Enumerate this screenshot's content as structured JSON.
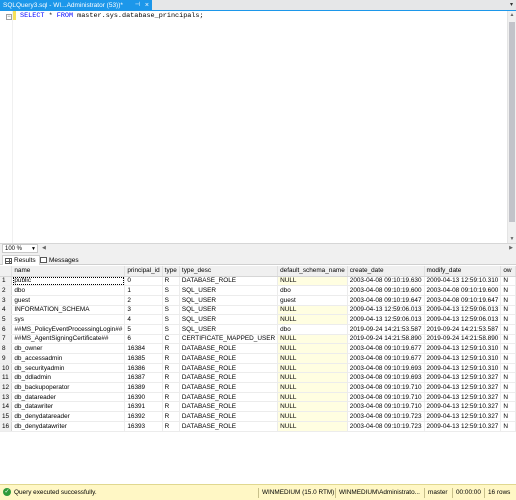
{
  "document_tab": {
    "title": "SQLQuery3.sql - WI...Administrator (53))*",
    "pin_icon": "pin-icon",
    "close_icon": "close-icon"
  },
  "editor": {
    "sql_keywords": [
      "SELECT",
      "FROM"
    ],
    "sql_star": " * ",
    "sql_table": " master.sys.database_principals;"
  },
  "zoom": {
    "value": "100 %"
  },
  "result_tabs": {
    "results_label": "Results",
    "messages_label": "Messages"
  },
  "grid": {
    "columns": [
      "name",
      "principal_id",
      "type",
      "type_desc",
      "default_schema_name",
      "create_date",
      "modify_date",
      "ow"
    ],
    "rows": [
      [
        "1",
        "public",
        "0",
        "R",
        "DATABASE_ROLE",
        "NULL",
        "2003-04-08 09:10:19.630",
        "2009-04-13 12:59:10.310",
        "N"
      ],
      [
        "2",
        "dbo",
        "1",
        "S",
        "SQL_USER",
        "dbo",
        "2003-04-08 09:10:19.600",
        "2003-04-08 09:10:19.600",
        "N"
      ],
      [
        "3",
        "guest",
        "2",
        "S",
        "SQL_USER",
        "guest",
        "2003-04-08 09:10:19.647",
        "2003-04-08 09:10:19.647",
        "N"
      ],
      [
        "4",
        "INFORMATION_SCHEMA",
        "3",
        "S",
        "SQL_USER",
        "NULL",
        "2009-04-13 12:59:06.013",
        "2009-04-13 12:59:06.013",
        "N"
      ],
      [
        "5",
        "sys",
        "4",
        "S",
        "SQL_USER",
        "NULL",
        "2009-04-13 12:59:06.013",
        "2009-04-13 12:59:06.013",
        "N"
      ],
      [
        "6",
        "##MS_PolicyEventProcessingLogin##",
        "5",
        "S",
        "SQL_USER",
        "dbo",
        "2019-09-24 14:21:53.587",
        "2019-09-24 14:21:53.587",
        "N"
      ],
      [
        "7",
        "##MS_AgentSigningCertificate##",
        "6",
        "C",
        "CERTIFICATE_MAPPED_USER",
        "NULL",
        "2019-09-24 14:21:58.890",
        "2019-09-24 14:21:58.890",
        "N"
      ],
      [
        "8",
        "db_owner",
        "16384",
        "R",
        "DATABASE_ROLE",
        "NULL",
        "2003-04-08 09:10:19.677",
        "2009-04-13 12:59:10.310",
        "N"
      ],
      [
        "9",
        "db_accessadmin",
        "16385",
        "R",
        "DATABASE_ROLE",
        "NULL",
        "2003-04-08 09:10:19.677",
        "2009-04-13 12:59:10.310",
        "N"
      ],
      [
        "10",
        "db_securityadmin",
        "16386",
        "R",
        "DATABASE_ROLE",
        "NULL",
        "2003-04-08 09:10:19.693",
        "2009-04-13 12:59:10.310",
        "N"
      ],
      [
        "11",
        "db_ddladmin",
        "16387",
        "R",
        "DATABASE_ROLE",
        "NULL",
        "2003-04-08 09:10:19.693",
        "2009-04-13 12:59:10.327",
        "N"
      ],
      [
        "12",
        "db_backupoperator",
        "16389",
        "R",
        "DATABASE_ROLE",
        "NULL",
        "2003-04-08 09:10:19.710",
        "2009-04-13 12:59:10.327",
        "N"
      ],
      [
        "13",
        "db_datareader",
        "16390",
        "R",
        "DATABASE_ROLE",
        "NULL",
        "2003-04-08 09:10:19.710",
        "2009-04-13 12:59:10.327",
        "N"
      ],
      [
        "14",
        "db_datawriter",
        "16391",
        "R",
        "DATABASE_ROLE",
        "NULL",
        "2003-04-08 09:10:19.710",
        "2009-04-13 12:59:10.327",
        "N"
      ],
      [
        "15",
        "db_denydatareader",
        "16392",
        "R",
        "DATABASE_ROLE",
        "NULL",
        "2003-04-08 09:10:19.723",
        "2009-04-13 12:59:10.327",
        "N"
      ],
      [
        "16",
        "db_denydatawriter",
        "16393",
        "R",
        "DATABASE_ROLE",
        "NULL",
        "2003-04-08 09:10:19.723",
        "2009-04-13 12:59:10.327",
        "N"
      ]
    ]
  },
  "status_bar": {
    "message": "Query executed successfully.",
    "server": "WINMEDIUM (15.0 RTM)",
    "user": "WINMEDIUM\\Administrato...",
    "database": "master",
    "elapsed": "00:00:00",
    "rows": "16 rows",
    "status_icon": "check-circle-icon"
  },
  "colors": {
    "accent": "#1c97ea",
    "keyword": "#0000ff",
    "null_cell": "#fffee1",
    "status_bar": "#fff7c5"
  }
}
